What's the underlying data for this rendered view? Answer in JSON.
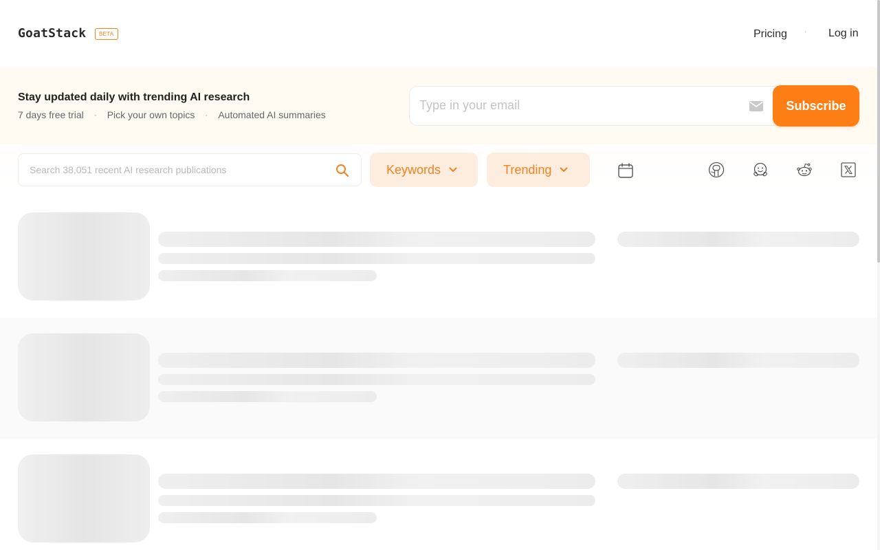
{
  "header": {
    "logo": "GoatStack",
    "badge": "BETA",
    "nav": {
      "pricing": "Pricing",
      "login": "Log in"
    }
  },
  "banner": {
    "title": "Stay updated daily with trending AI research",
    "features": [
      "7 days free trial",
      "Pick your own topics",
      "Automated AI summaries"
    ],
    "email_placeholder": "Type in your email",
    "subscribe_label": "Subscribe"
  },
  "toolbar": {
    "search_placeholder": "Search 38,051 recent AI research publications",
    "keywords_label": "Keywords",
    "trending_label": "Trending",
    "icons": [
      "calendar-icon",
      "github-icon",
      "huggingface-icon",
      "reddit-icon",
      "x-icon"
    ]
  },
  "colors": {
    "accent": "#fd7e14",
    "accent_text": "#f58220",
    "pill_bg": "#fdeddf",
    "banner_bg": "#fffbf3"
  },
  "content": {
    "state": "loading-skeleton"
  }
}
